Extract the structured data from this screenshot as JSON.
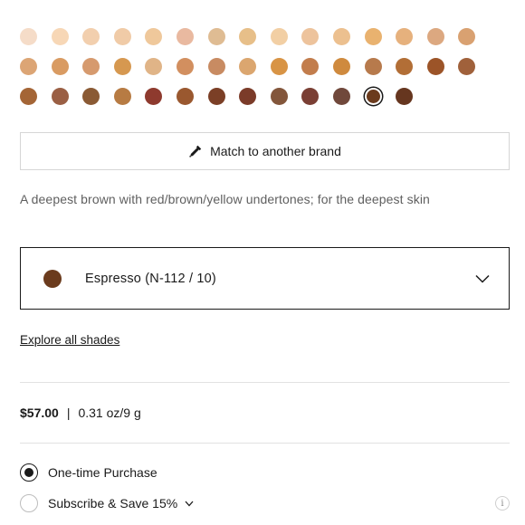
{
  "swatches": {
    "rows": [
      [
        "#f5dcc8",
        "#f7d7b6",
        "#f2cfae",
        "#f0cba7",
        "#efc89b",
        "#e9b9a0",
        "#dfbc93",
        "#e7bf89",
        "#f2cfa4",
        "#edc39c",
        "#ecc08f",
        "#e9b26f",
        "#e6b17d",
        "#dca880",
        "#d9a171"
      ],
      [
        "#dca575",
        "#d99b62",
        "#d69a6e",
        "#d69850",
        "#e0b487",
        "#d28f5f",
        "#c88b62",
        "#dba66f",
        "#d89445",
        "#c27d4c",
        "#cf8a3e",
        "#b77a4c",
        "#b26e36",
        "#9c5428",
        "#a0613b"
      ],
      [
        "#a46536",
        "#9a5f44",
        "#8a5a34",
        "#b77b43",
        "#8e3a2e",
        "#9a582f",
        "#7b3f26",
        "#7b3b29",
        "#83563b",
        "#7a3f34",
        "#70483b",
        "#6b3b1d",
        "#66361f"
      ]
    ],
    "selected_row": 2,
    "selected_index": 11
  },
  "match_button": {
    "label": "Match to another brand",
    "icon": "eyedropper-icon"
  },
  "shade_description": "A deepest brown with red/brown/yellow undertones; for the deepest skin",
  "shade_select": {
    "label": "Espresso (N-112 / 10)",
    "color": "#6b3b1d",
    "icon": "chevron-down-icon"
  },
  "explore_link": "Explore all shades",
  "price": {
    "amount": "$57.00",
    "separator": "|",
    "size": "0.31 oz/9 g"
  },
  "purchase_options": {
    "one_time": {
      "label": "One-time Purchase",
      "selected": true
    },
    "subscribe": {
      "label": "Subscribe & Save 15%",
      "selected": false,
      "icon": "chevron-down-icon"
    }
  },
  "info_icon": {
    "glyph": "i",
    "name": "info-icon"
  }
}
